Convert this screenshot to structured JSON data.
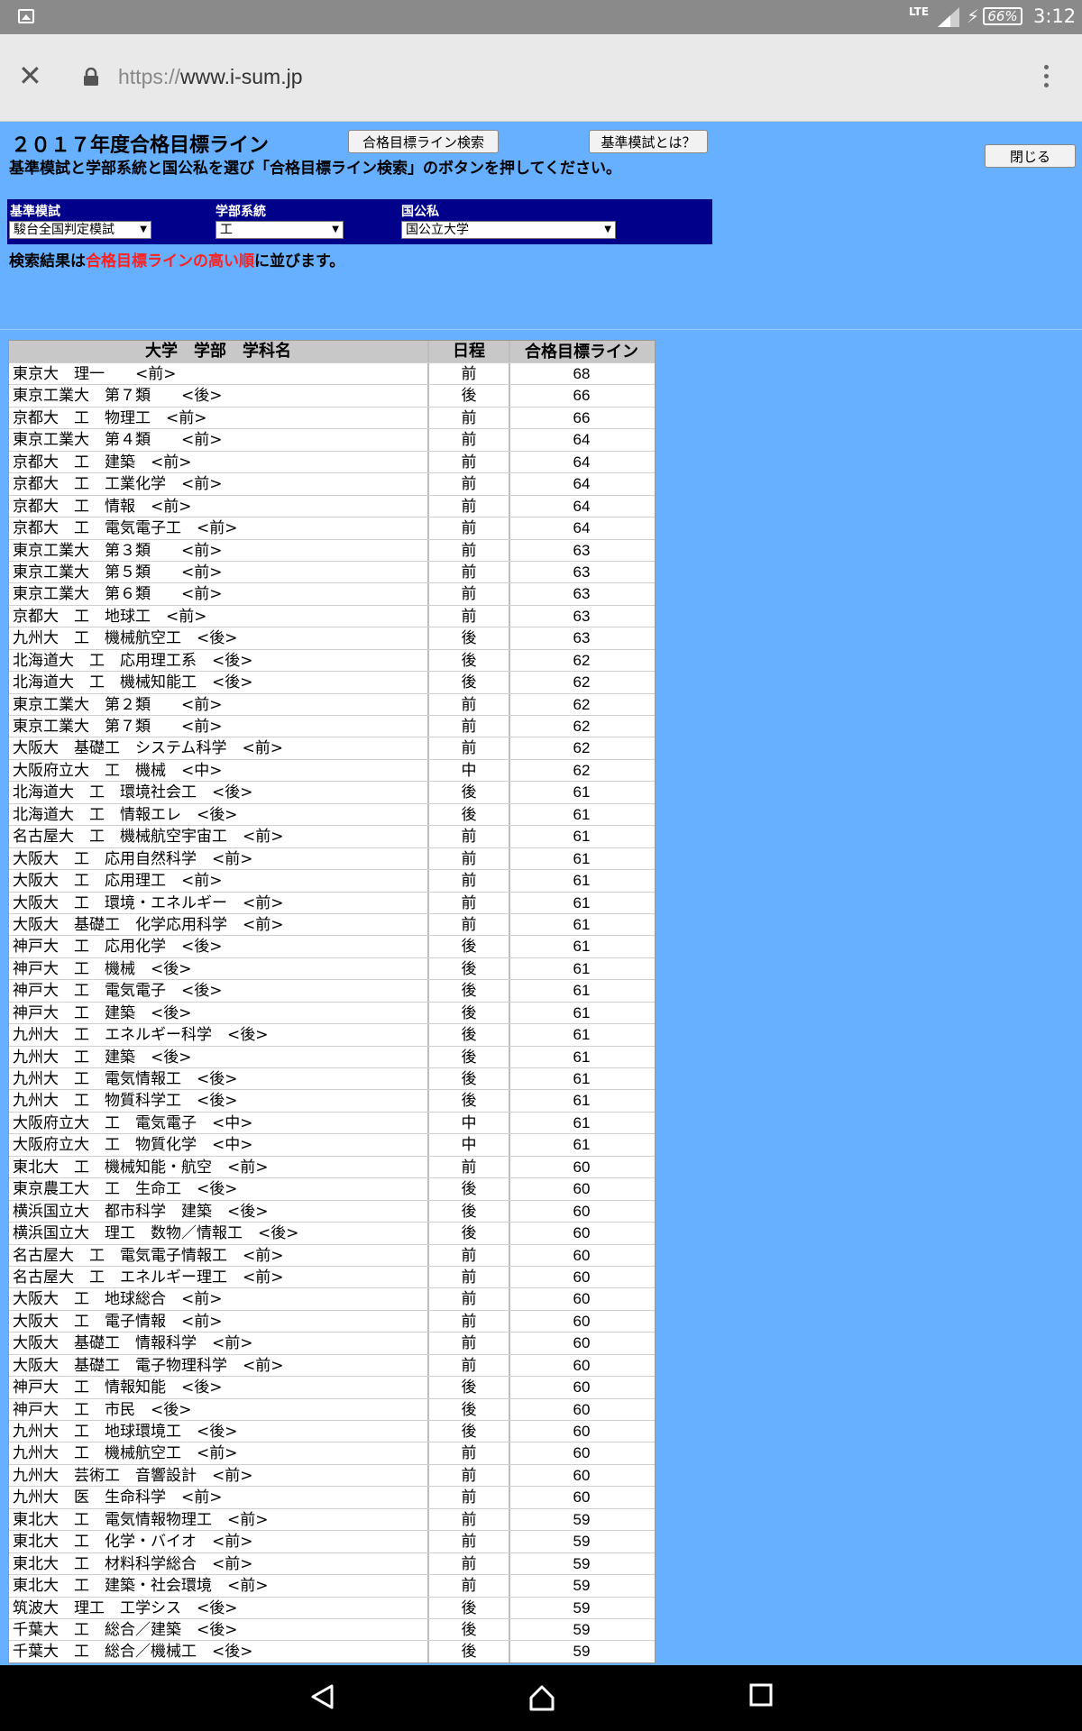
{
  "status_bar": {
    "network": "LTE",
    "battery": "66%",
    "time": "3:12"
  },
  "browser": {
    "url_scheme": "https://",
    "url_host": "www.i-sum.jp"
  },
  "page": {
    "title": "２０１７年度合格目標ライン",
    "search_button": "合格目標ライン検索",
    "about_button": "基準模試とは？",
    "close_button": "閉じる",
    "instructions": "基準模試と学部系統と国公私を選び「合格目標ライン検索」のボタンを押してください。",
    "filters": {
      "exam_label": "基準模試",
      "exam_value": "駿台全国判定模試",
      "faculty_label": "学部系統",
      "faculty_value": "工",
      "type_label": "国公私",
      "type_value": "国公立大学"
    },
    "note_prefix": "検索結果は",
    "note_highlight": "合格目標ラインの高い順",
    "note_suffix": "に並びます。"
  },
  "table": {
    "headers": [
      "大学　学部　学科名",
      "日程",
      "合格目標ライン"
    ],
    "rows": [
      [
        "東京大　理一　　<前>",
        "前",
        "68"
      ],
      [
        "東京工業大　第７類　　<後>",
        "後",
        "66"
      ],
      [
        "京都大　工　物理工　<前>",
        "前",
        "66"
      ],
      [
        "東京工業大　第４類　　<前>",
        "前",
        "64"
      ],
      [
        "京都大　工　建築　<前>",
        "前",
        "64"
      ],
      [
        "京都大　工　工業化学　<前>",
        "前",
        "64"
      ],
      [
        "京都大　工　情報　<前>",
        "前",
        "64"
      ],
      [
        "京都大　工　電気電子工　<前>",
        "前",
        "64"
      ],
      [
        "東京工業大　第３類　　<前>",
        "前",
        "63"
      ],
      [
        "東京工業大　第５類　　<前>",
        "前",
        "63"
      ],
      [
        "東京工業大　第６類　　<前>",
        "前",
        "63"
      ],
      [
        "京都大　工　地球工　<前>",
        "前",
        "63"
      ],
      [
        "九州大　工　機械航空工　<後>",
        "後",
        "63"
      ],
      [
        "北海道大　工　応用理工系　<後>",
        "後",
        "62"
      ],
      [
        "北海道大　工　機械知能工　<後>",
        "後",
        "62"
      ],
      [
        "東京工業大　第２類　　<前>",
        "前",
        "62"
      ],
      [
        "東京工業大　第７類　　<前>",
        "前",
        "62"
      ],
      [
        "大阪大　基礎工　システム科学　<前>",
        "前",
        "62"
      ],
      [
        "大阪府立大　工　機械　<中>",
        "中",
        "62"
      ],
      [
        "北海道大　工　環境社会工　<後>",
        "後",
        "61"
      ],
      [
        "北海道大　工　情報エレ　<後>",
        "後",
        "61"
      ],
      [
        "名古屋大　工　機械航空宇宙工　<前>",
        "前",
        "61"
      ],
      [
        "大阪大　工　応用自然科学　<前>",
        "前",
        "61"
      ],
      [
        "大阪大　工　応用理工　<前>",
        "前",
        "61"
      ],
      [
        "大阪大　工　環境・エネルギー　<前>",
        "前",
        "61"
      ],
      [
        "大阪大　基礎工　化学応用科学　<前>",
        "前",
        "61"
      ],
      [
        "神戸大　工　応用化学　<後>",
        "後",
        "61"
      ],
      [
        "神戸大　工　機械　<後>",
        "後",
        "61"
      ],
      [
        "神戸大　工　電気電子　<後>",
        "後",
        "61"
      ],
      [
        "神戸大　工　建築　<後>",
        "後",
        "61"
      ],
      [
        "九州大　工　エネルギー科学　<後>",
        "後",
        "61"
      ],
      [
        "九州大　工　建築　<後>",
        "後",
        "61"
      ],
      [
        "九州大　工　電気情報工　<後>",
        "後",
        "61"
      ],
      [
        "九州大　工　物質科学工　<後>",
        "後",
        "61"
      ],
      [
        "大阪府立大　工　電気電子　<中>",
        "中",
        "61"
      ],
      [
        "大阪府立大　工　物質化学　<中>",
        "中",
        "61"
      ],
      [
        "東北大　工　機械知能・航空　<前>",
        "前",
        "60"
      ],
      [
        "東京農工大　工　生命工　<後>",
        "後",
        "60"
      ],
      [
        "横浜国立大　都市科学　建築　<後>",
        "後",
        "60"
      ],
      [
        "横浜国立大　理工　数物／情報工　<後>",
        "後",
        "60"
      ],
      [
        "名古屋大　工　電気電子情報工　<前>",
        "前",
        "60"
      ],
      [
        "名古屋大　工　エネルギー理工　<前>",
        "前",
        "60"
      ],
      [
        "大阪大　工　地球総合　<前>",
        "前",
        "60"
      ],
      [
        "大阪大　工　電子情報　<前>",
        "前",
        "60"
      ],
      [
        "大阪大　基礎工　情報科学　<前>",
        "前",
        "60"
      ],
      [
        "大阪大　基礎工　電子物理科学　<前>",
        "前",
        "60"
      ],
      [
        "神戸大　工　情報知能　<後>",
        "後",
        "60"
      ],
      [
        "神戸大　工　市民　<後>",
        "後",
        "60"
      ],
      [
        "九州大　工　地球環境工　<後>",
        "後",
        "60"
      ],
      [
        "九州大　工　機械航空工　<前>",
        "前",
        "60"
      ],
      [
        "九州大　芸術工　音響設計　<前>",
        "前",
        "60"
      ],
      [
        "九州大　医　生命科学　<前>",
        "前",
        "60"
      ],
      [
        "東北大　工　電気情報物理工　<前>",
        "前",
        "59"
      ],
      [
        "東北大　工　化学・バイオ　<前>",
        "前",
        "59"
      ],
      [
        "東北大　工　材料科学総合　<前>",
        "前",
        "59"
      ],
      [
        "東北大　工　建築・社会環境　<前>",
        "前",
        "59"
      ],
      [
        "筑波大　理工　工学シス　<後>",
        "後",
        "59"
      ],
      [
        "千葉大　工　総合／建築　<後>",
        "後",
        "59"
      ],
      [
        "千葉大　工　総合／機械工　<後>",
        "後",
        "59"
      ]
    ]
  }
}
